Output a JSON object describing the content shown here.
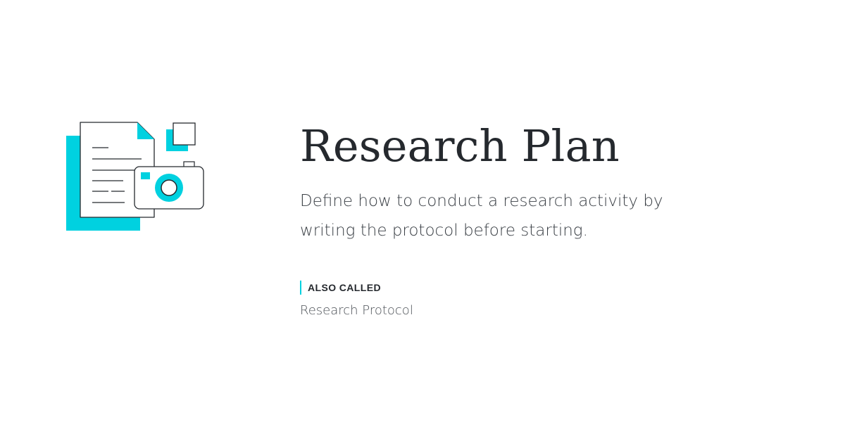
{
  "page": {
    "title": "Research Plan",
    "description": "Define how to conduct a research activity by writing the protocol before starting.",
    "also_called_label": "ALSO CALLED",
    "also_called_value": "Research Protocol"
  },
  "colors": {
    "accent": "#00d1e0",
    "title_text": "#25292e",
    "body_text": "#3a3f45",
    "outline": "#25292e",
    "background": "#ffffff"
  },
  "icons": {
    "illustration": "document-with-camera-icon"
  }
}
